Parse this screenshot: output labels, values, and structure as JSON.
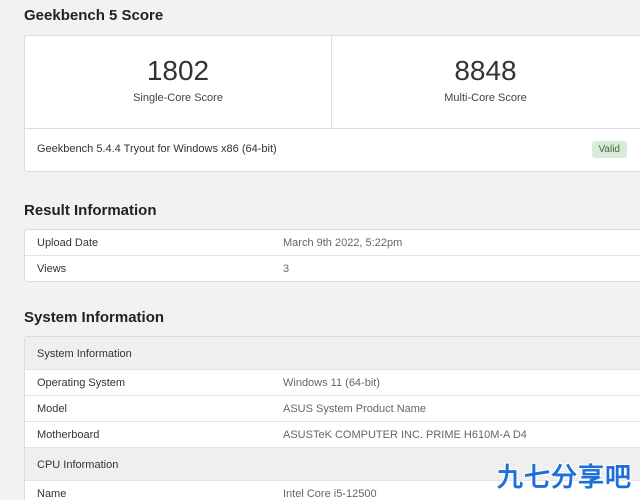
{
  "score_section": {
    "title": "Geekbench 5 Score",
    "single_core": {
      "value": "1802",
      "label": "Single-Core Score"
    },
    "multi_core": {
      "value": "8848",
      "label": "Multi-Core Score"
    },
    "version": "Geekbench 5.4.4 Tryout for Windows x86 (64-bit)",
    "badge": "Valid"
  },
  "result_section": {
    "title": "Result Information",
    "rows": [
      {
        "key": "Upload Date",
        "value": "March 9th 2022, 5:22pm"
      },
      {
        "key": "Views",
        "value": "3"
      }
    ]
  },
  "system_section": {
    "title": "System Information",
    "group_system": "System Information",
    "rows_system": [
      {
        "key": "Operating System",
        "value": "Windows 11 (64-bit)"
      },
      {
        "key": "Model",
        "value": "ASUS System Product Name"
      },
      {
        "key": "Motherboard",
        "value": "ASUSTeK COMPUTER INC. PRIME H610M-A D4"
      }
    ],
    "group_cpu": "CPU Information",
    "rows_cpu": [
      {
        "key": "Name",
        "value": "Intel Core i5-12500"
      }
    ]
  },
  "watermark": "九七分享吧",
  "colors": {
    "background": "#f2f2f2",
    "card": "#ffffff",
    "valid_badge_bg": "#d9ead9",
    "valid_badge_text": "#3d6b3d",
    "watermark": "#1e6fd9"
  }
}
